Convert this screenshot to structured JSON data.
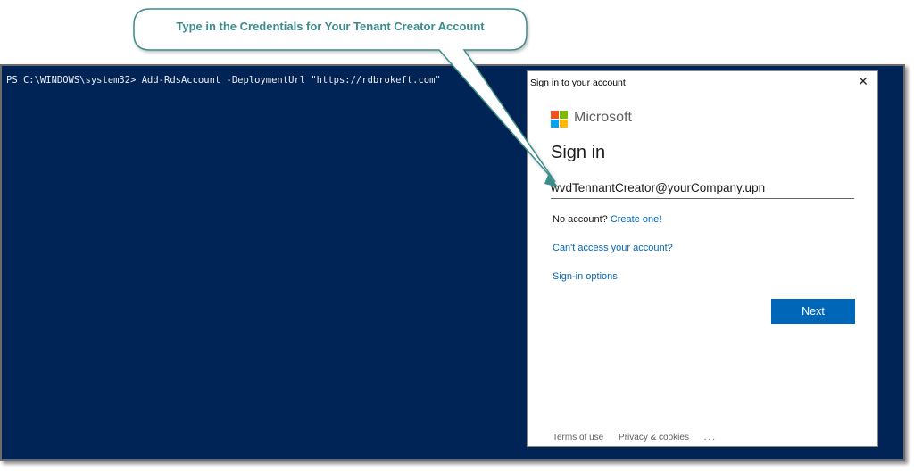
{
  "callout": {
    "text": "Type in the Credentials for Your Tenant Creator Account",
    "color": "#3b8c8c"
  },
  "console": {
    "background": "#012456",
    "command_line": "PS C:\\WINDOWS\\system32> Add-RdsAccount -DeploymentUrl \"https://rdbroke"
  },
  "dialog": {
    "title": "Sign in to your account",
    "close_icon": "close-icon",
    "brand": "Microsoft",
    "heading": "Sign in",
    "email_value": "wvdTennantCreator@yourCompany.upn",
    "no_account_text": "No account?",
    "create_one_link": "Create one!",
    "cant_access_link": "Can't access your account?",
    "signin_options_link": "Sign-in options",
    "next_button": "Next",
    "footer": {
      "terms": "Terms of use",
      "privacy": "Privacy & cookies",
      "more": "..."
    },
    "accent_color": "#0067b8"
  }
}
